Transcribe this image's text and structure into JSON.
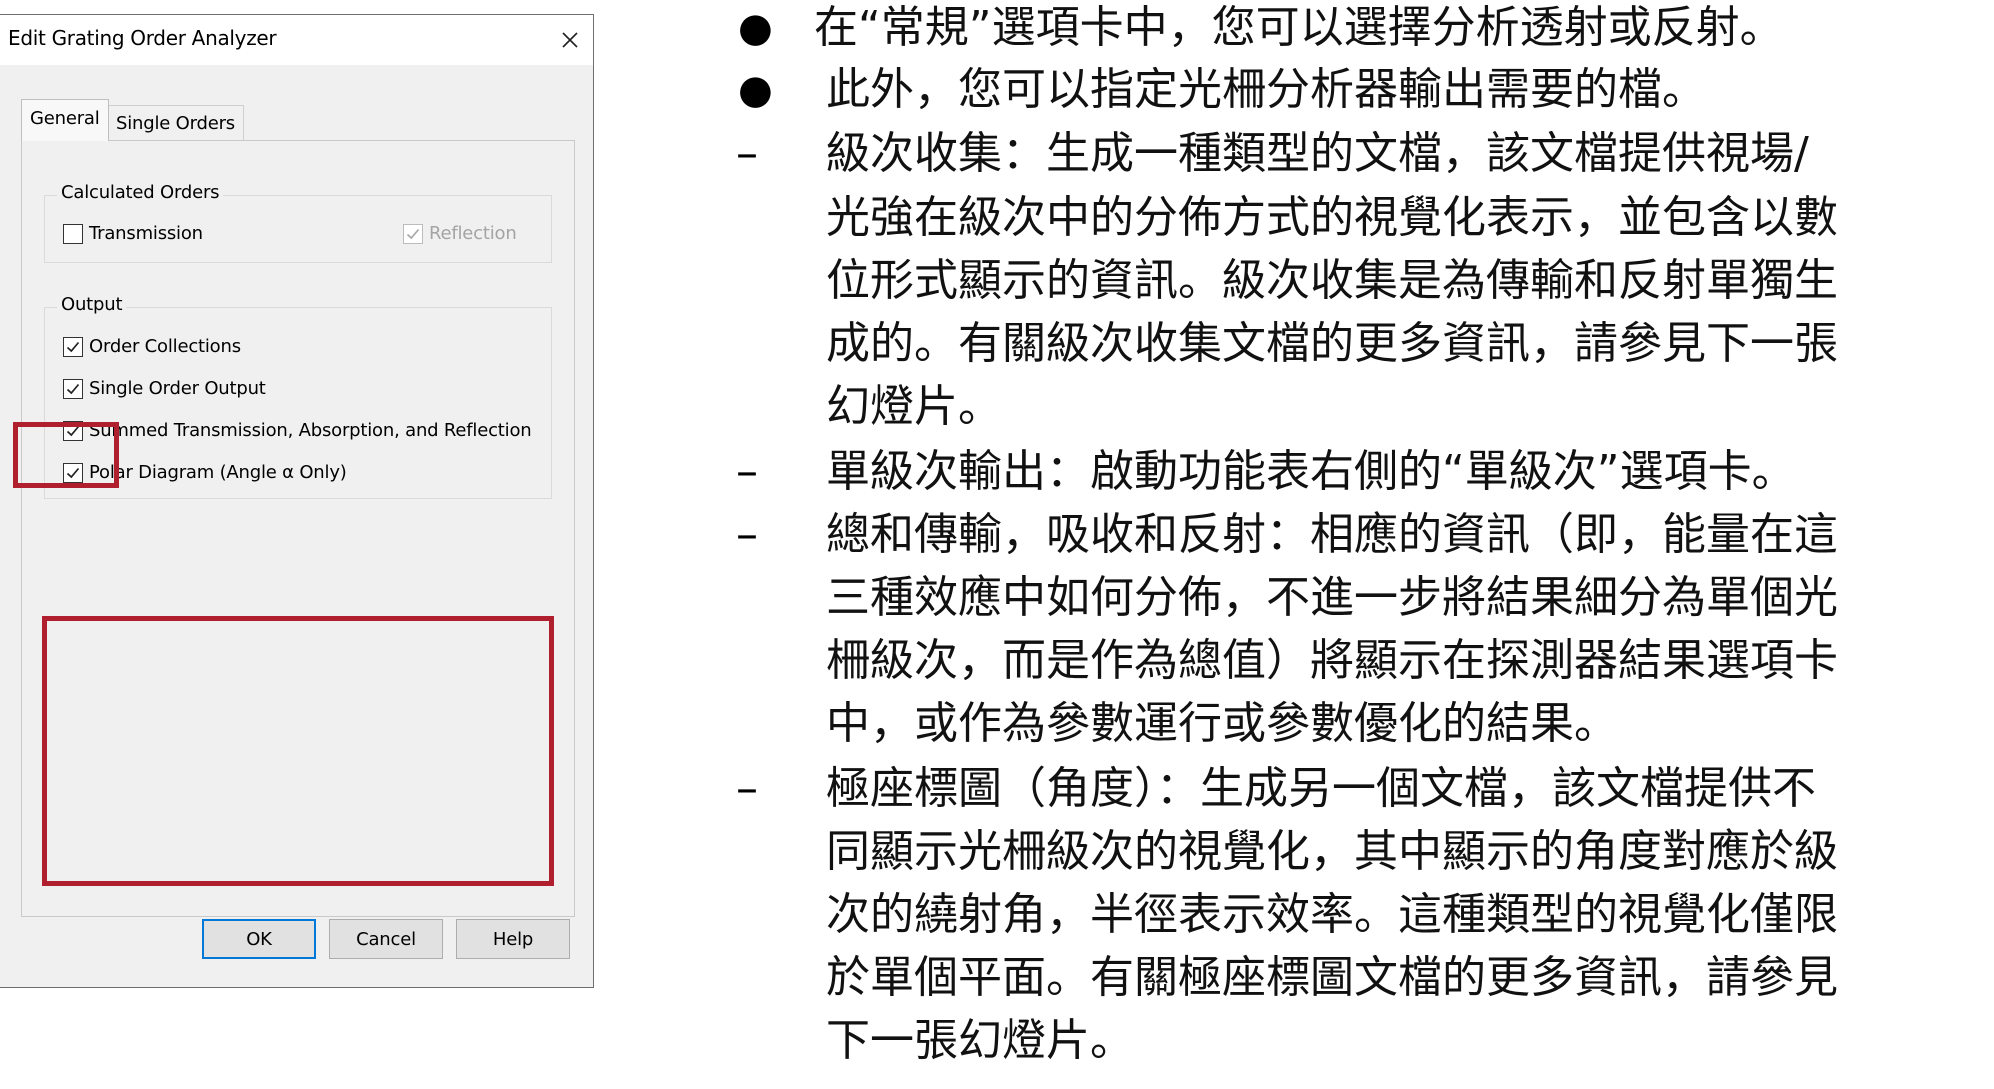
{
  "dialog": {
    "title": "Edit Grating Order Analyzer",
    "tabs": [
      {
        "label": "General",
        "active": true
      },
      {
        "label": "Single Orders",
        "active": false
      }
    ],
    "calculated_orders": {
      "title": "Calculated Orders",
      "transmission": {
        "label": "Transmission",
        "checked": false,
        "enabled": true
      },
      "reflection": {
        "label": "Reflection",
        "checked": true,
        "enabled": false
      }
    },
    "output": {
      "title": "Output",
      "items": [
        {
          "label": "Order Collections",
          "checked": true
        },
        {
          "label": "Single Order Output",
          "checked": true
        },
        {
          "label": "Summed Transmission, Absorption, and Reflection",
          "checked": true
        },
        {
          "label": "Polar Diagram (Angle α Only)",
          "checked": true
        }
      ]
    },
    "buttons": {
      "ok": "OK",
      "cancel": "Cancel",
      "help": "Help"
    },
    "highlight_color": "#b01f2e"
  },
  "notes": {
    "bullet_marker": "●",
    "dash_marker": "–",
    "items": [
      {
        "type": "bullet",
        "lines": [
          "在“常規”選項卡中，您可以選擇分析透射或反射。"
        ]
      },
      {
        "type": "bullet",
        "lines": [
          "此外，您可以指定光柵分析器輸出需要的檔。"
        ]
      },
      {
        "type": "dash",
        "lines": [
          "級次收集：生成一種類型的文檔，該文檔提供視場/",
          "光強在級次中的分佈方式的視覺化表示，並包含以數",
          "位形式顯示的資訊。級次收集是為傳輸和反射單獨生",
          "成的。有關級次收集文檔的更多資訊，請參見下一張",
          "幻燈片。"
        ]
      },
      {
        "type": "dash",
        "lines": [
          "單級次輸出：啟動功能表右側的“單級次”選項卡。"
        ]
      },
      {
        "type": "dash",
        "lines": [
          "總和傳輸，吸收和反射：相應的資訊（即，能量在這",
          "三種效應中如何分佈，不進一步將結果細分為單個光",
          "柵級次，而是作為總值）將顯示在探測器結果選項卡",
          "中，或作為參數運行或參數優化的結果。"
        ]
      },
      {
        "type": "dash",
        "lines": [
          "極座標圖（角度）：生成另一個文檔，該文檔提供不",
          "同顯示光柵級次的視覺化，其中顯示的角度對應於級",
          "次的繞射角，半徑表示效率。這種類型的視覺化僅限",
          "於單個平面。有關極座標圖文檔的更多資訊，請參見",
          "下一張幻燈片。"
        ]
      }
    ]
  }
}
